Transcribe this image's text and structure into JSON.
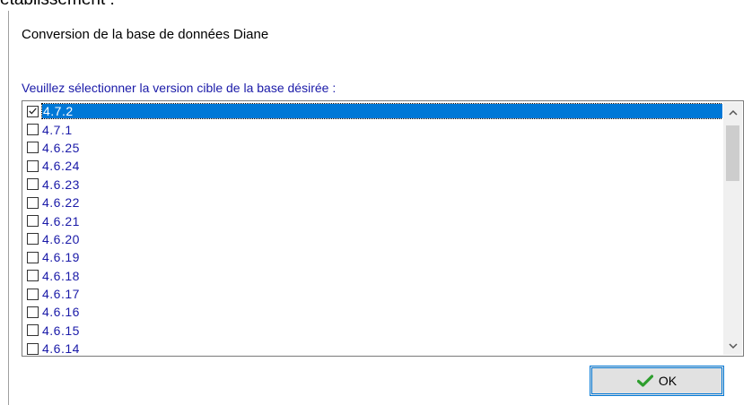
{
  "background": {
    "title_fragment": "établissement :"
  },
  "dialog": {
    "heading": "Conversion de la base de données Diane",
    "list_label": "Veuillez sélectionner la version cible de la base désirée :",
    "versions": [
      {
        "label": "4.7.2",
        "checked": true,
        "selected": true
      },
      {
        "label": "4.7.1",
        "checked": false,
        "selected": false
      },
      {
        "label": "4.6.25",
        "checked": false,
        "selected": false
      },
      {
        "label": "4.6.24",
        "checked": false,
        "selected": false
      },
      {
        "label": "4.6.23",
        "checked": false,
        "selected": false
      },
      {
        "label": "4.6.22",
        "checked": false,
        "selected": false
      },
      {
        "label": "4.6.21",
        "checked": false,
        "selected": false
      },
      {
        "label": "4.6.20",
        "checked": false,
        "selected": false
      },
      {
        "label": "4.6.19",
        "checked": false,
        "selected": false
      },
      {
        "label": "4.6.18",
        "checked": false,
        "selected": false
      },
      {
        "label": "4.6.17",
        "checked": false,
        "selected": false
      },
      {
        "label": "4.6.16",
        "checked": false,
        "selected": false
      },
      {
        "label": "4.6.15",
        "checked": false,
        "selected": false
      },
      {
        "label": "4.6.14",
        "checked": false,
        "selected": false
      }
    ],
    "ok_label": "OK",
    "colors": {
      "selection": "#0078d7",
      "item_text": "#1a1aa8",
      "ok_check": "#2e9e2e"
    }
  }
}
